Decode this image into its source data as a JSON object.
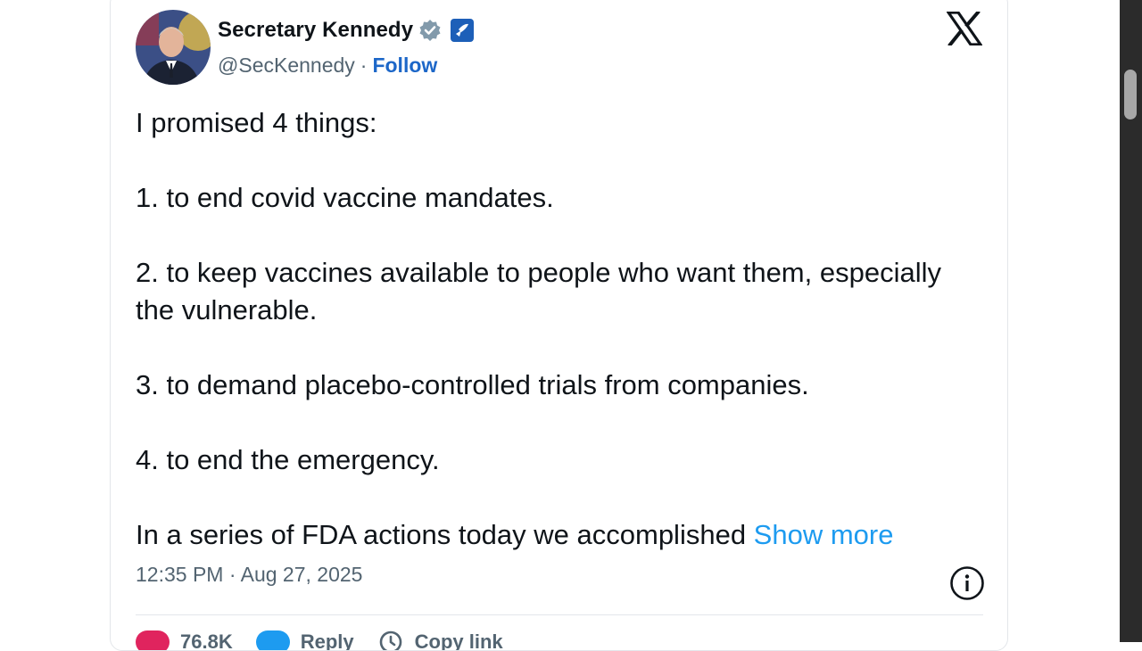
{
  "tweet": {
    "author": {
      "display_name": "Secretary Kennedy",
      "handle": "@SecKennedy",
      "separator": "·",
      "follow_label": "Follow",
      "avatar_icon": "avatar-portrait-icon",
      "verified_icon": "verified-badge-icon",
      "affiliation_icon": "hhs-affiliate-icon"
    },
    "platform_icon": "x-logo-icon",
    "body": {
      "intro": "I promised 4 things:",
      "item1": "1. to end covid vaccine mandates.",
      "item2": "2. to keep vaccines available to people who want them, especially the vulnerable.",
      "item3": "3. to demand placebo-controlled trials from companies.",
      "item4": "4. to end the emergency.",
      "truncated": "In a series of FDA actions today we accomplished ",
      "show_more": "Show more"
    },
    "timestamp": "12:35 PM · Aug 27, 2025",
    "actions": {
      "likes": "76.8K",
      "reply": "Reply",
      "copy_link": "Copy link"
    }
  },
  "colors": {
    "link_blue": "#1d9bf0",
    "follow_blue": "#1d67c8",
    "like_pink": "#e0245e",
    "text": "#0f1419",
    "muted": "#536471"
  }
}
